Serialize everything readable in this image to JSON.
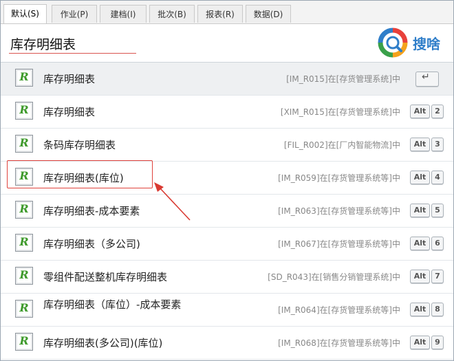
{
  "tabs": [
    {
      "label": "默认(S)",
      "active": true
    },
    {
      "label": "作业(P)",
      "active": false
    },
    {
      "label": "建档(I)",
      "active": false
    },
    {
      "label": "批次(B)",
      "active": false
    },
    {
      "label": "报表(R)",
      "active": false
    },
    {
      "label": "数据(D)",
      "active": false
    }
  ],
  "search": {
    "value": "库存明细表"
  },
  "brand": {
    "text": "搜啥",
    "icon": "magnifier-logo-icon"
  },
  "results": [
    {
      "icon_letter": "R",
      "title": "库存明细表",
      "source": "[IM_R015]在[存货管理系统]中",
      "hotkey": "enter"
    },
    {
      "icon_letter": "R",
      "title": "库存明细表",
      "source": "[XIM_R015]在[存货管理系统]中",
      "hotkey_mod": "Alt",
      "hotkey_num": "2"
    },
    {
      "icon_letter": "R",
      "title": "条码库存明细表",
      "source": "[FIL_R002]在[厂内智能物流]中",
      "hotkey_mod": "Alt",
      "hotkey_num": "3"
    },
    {
      "icon_letter": "R",
      "title": "库存明细表(库位)",
      "source": "[IM_R059]在[存货管理系统等]中",
      "hotkey_mod": "Alt",
      "hotkey_num": "4"
    },
    {
      "icon_letter": "R",
      "title": "库存明细表-成本要素",
      "source": "[IM_R063]在[存货管理系统等]中",
      "hotkey_mod": "Alt",
      "hotkey_num": "5"
    },
    {
      "icon_letter": "R",
      "title": "库存明细表（多公司)",
      "source": "[IM_R067]在[存货管理系统等]中",
      "hotkey_mod": "Alt",
      "hotkey_num": "6"
    },
    {
      "icon_letter": "R",
      "title": "零组件配送整机库存明细表",
      "source": "[SD_R043]在[销售分销管理系统]中",
      "hotkey_mod": "Alt",
      "hotkey_num": "7"
    },
    {
      "icon_letter": "R",
      "title": "库存明细表（库位）-成本要素",
      "source": "[IM_R064]在[存货管理系统等]中",
      "hotkey_mod": "Alt",
      "hotkey_num": "8"
    },
    {
      "icon_letter": "R",
      "title": "库存明细表(多公司)(库位)",
      "source": "[IM_R068]在[存货管理系统等]中",
      "hotkey_mod": "Alt",
      "hotkey_num": "9"
    }
  ],
  "colors": {
    "accent": "#2f7ec9",
    "annotation": "#e0413b",
    "icon_letter": "#3e9a2b"
  }
}
